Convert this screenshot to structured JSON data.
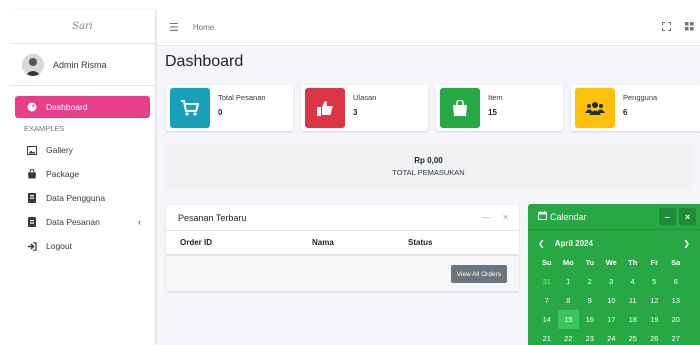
{
  "brand": {
    "logo_text": "Sari"
  },
  "user": {
    "name": "Admin Risma"
  },
  "sidebar": {
    "active": {
      "label": "Dashboard",
      "icon": "dashboard-icon"
    },
    "section": "EXAMPLES",
    "items": [
      {
        "label": "Gallery",
        "icon": "image-icon"
      },
      {
        "label": "Package",
        "icon": "shopping-bag-icon"
      },
      {
        "label": "Data Pengguna",
        "icon": "book-icon"
      },
      {
        "label": "Data Pesanan",
        "icon": "book-icon"
      },
      {
        "label": "Logout",
        "icon": "sign-out-icon"
      }
    ]
  },
  "topnav": {
    "home": "Home"
  },
  "page": {
    "title": "Dashboard"
  },
  "stats": [
    {
      "label": "Total Pesanan",
      "value": "0",
      "color": "#17a2b8",
      "icon": "cart-icon"
    },
    {
      "label": "Ulasan",
      "value": "3",
      "color": "#dc3545",
      "icon": "thumbs-up-icon"
    },
    {
      "label": "Item",
      "value": "15",
      "color": "#28a745",
      "icon": "bag-icon"
    },
    {
      "label": "Pengguna",
      "value": "6",
      "color": "#ffc107",
      "icon": "users-icon"
    }
  ],
  "total": {
    "amount": "Rp 0,00",
    "label": "TOTAL PEMASUKAN"
  },
  "orders": {
    "title": "Pesanan Terbaru",
    "columns": [
      "Order ID",
      "Nama",
      "Status"
    ],
    "button": "View All Orders"
  },
  "calendar": {
    "title": "Calendar",
    "month": "April 2024",
    "days_of_week": [
      "Su",
      "Mo",
      "Tu",
      "We",
      "Th",
      "Fr",
      "Sa"
    ],
    "weeks": [
      [
        "31",
        "1",
        "2",
        "3",
        "4",
        "5",
        "6"
      ],
      [
        "7",
        "8",
        "9",
        "10",
        "11",
        "12",
        "13"
      ],
      [
        "14",
        "15",
        "16",
        "17",
        "18",
        "19",
        "20"
      ],
      [
        "21",
        "22",
        "23",
        "24",
        "25",
        "26",
        "27"
      ]
    ],
    "today": "15",
    "color": "#28a745"
  }
}
